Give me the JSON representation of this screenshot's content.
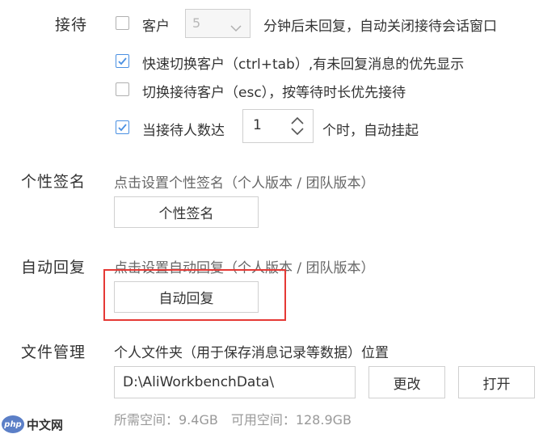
{
  "reception": {
    "label": "接待",
    "customer_label": "客户",
    "minutes_select_value": "5",
    "minutes_suffix": "分钟后未回复，自动关闭接待会话窗口",
    "quick_switch_text": "快速切换客户（ctrl+tab）,有未回复消息的优先显示",
    "switch_reception_text": "切换接待客户（esc），按等待时长优先接待",
    "limit_prefix": "当接待人数达",
    "limit_value": "1",
    "limit_suffix": "个时，自动挂起"
  },
  "signature": {
    "label": "个性签名",
    "hint": "点击设置个性签名（个人版本 / 团队版本）",
    "button_label": "个性签名"
  },
  "auto_reply": {
    "label": "自动回复",
    "hint": "点击设置自动回复（个人版本 / 团队版本）",
    "button_label": "自动回复"
  },
  "file_management": {
    "label": "文件管理",
    "description": "个人文件夹（用于保存消息记录等数据）位置",
    "path_value": "D:\\AliWorkbenchData\\",
    "change_button": "更改",
    "open_button": "打开",
    "space_info": "所需空间：9.4GB　可用空间：128.9GB"
  },
  "watermark": {
    "logo_text": "php",
    "site_text": "中文网"
  },
  "colors": {
    "check_accent": "#4a90e2",
    "highlight": "#e53935"
  }
}
